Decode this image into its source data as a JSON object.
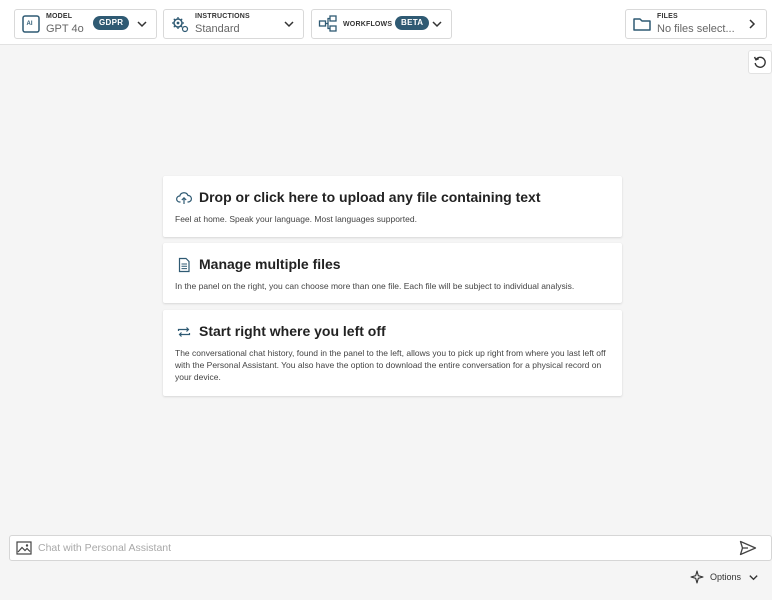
{
  "toolbar": {
    "model": {
      "caption": "MODEL",
      "value": "GPT 4o",
      "badge": "GDPR",
      "icon": "ai-chip-icon"
    },
    "instructions": {
      "caption": "INSTRUCTIONS",
      "value": "Standard",
      "icon": "gears-icon"
    },
    "workflows": {
      "caption": "WORKFLOWS",
      "badge": "BETA",
      "icon": "workflow-icon"
    },
    "files": {
      "caption": "FILES",
      "value": "No files select...",
      "icon": "folder-icon"
    }
  },
  "cards": [
    {
      "title": "Drop or click here to upload any file containing text",
      "body": "Feel at home. Speak your language. Most languages supported.",
      "icon": "cloud-upload-icon"
    },
    {
      "title": "Manage multiple files",
      "body": "In the panel on the right, you can choose more than one file. Each file will be subject to individual analysis.",
      "icon": "document-icon"
    },
    {
      "title": "Start right where you left off",
      "body": "The conversational chat history, found in the panel to the left, allows you to pick up right from where you last left off with the Personal Assistant. You also have the option to download the entire conversation for a physical record on your device.",
      "icon": "sync-icon"
    }
  ],
  "chat": {
    "placeholder": "Chat with Personal Assistant",
    "value": ""
  },
  "options": {
    "label": "Options"
  },
  "colors": {
    "badge": "#2f5a73",
    "background": "#f5f5f5",
    "card": "#ffffff"
  }
}
